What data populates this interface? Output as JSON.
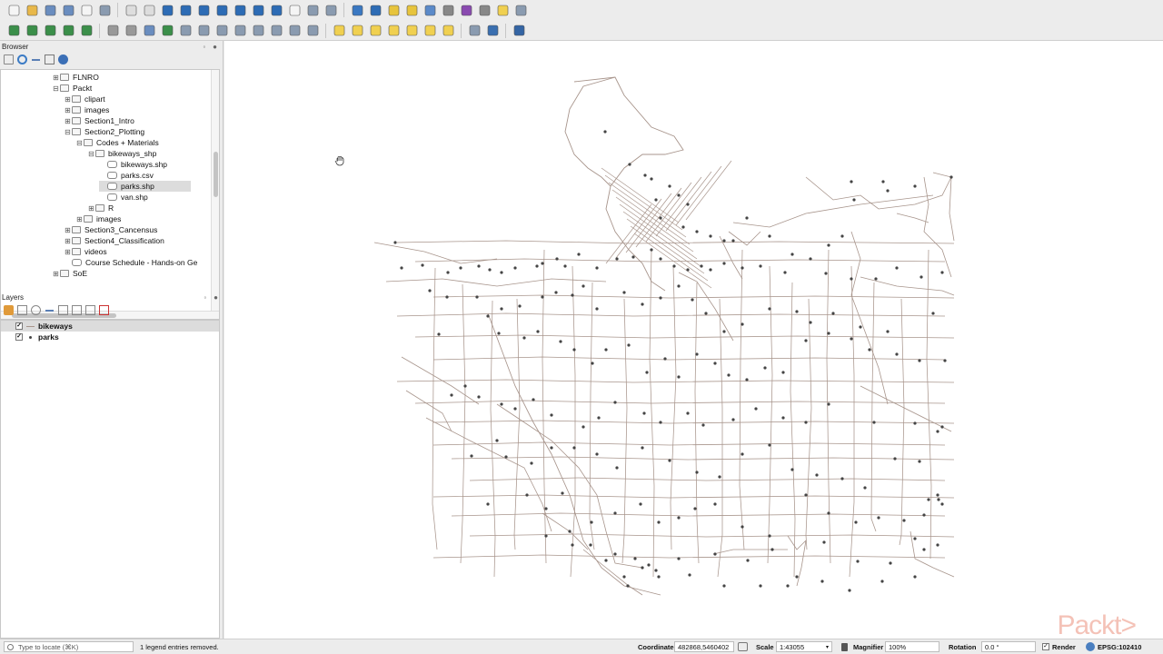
{
  "browser": {
    "title": "Browser",
    "tree": [
      {
        "label": "FLNRO",
        "depth": 0,
        "exp": "+"
      },
      {
        "label": "Packt",
        "depth": 0,
        "exp": "−"
      },
      {
        "label": "clipart",
        "depth": 1,
        "exp": "+"
      },
      {
        "label": "images",
        "depth": 1,
        "exp": "+"
      },
      {
        "label": "Section1_Intro",
        "depth": 1,
        "exp": "+"
      },
      {
        "label": "Section2_Plotting",
        "depth": 1,
        "exp": "−"
      },
      {
        "label": "Codes + Materials",
        "depth": 2,
        "exp": "−"
      },
      {
        "label": "bikeways_shp",
        "depth": 3,
        "exp": "−"
      },
      {
        "label": "bikeways.shp",
        "depth": 4,
        "exp": "",
        "file": true
      },
      {
        "label": "parks.csv",
        "depth": 4,
        "exp": "",
        "file": true
      },
      {
        "label": "parks.shp",
        "depth": 4,
        "exp": "",
        "file": true,
        "selected": true
      },
      {
        "label": "van.shp",
        "depth": 4,
        "exp": "",
        "file": true
      },
      {
        "label": "R",
        "depth": 3,
        "exp": "+"
      },
      {
        "label": "images",
        "depth": 2,
        "exp": "+"
      },
      {
        "label": "Section3_Cancensus",
        "depth": 1,
        "exp": "+"
      },
      {
        "label": "Section4_Classification",
        "depth": 1,
        "exp": "+"
      },
      {
        "label": "videos",
        "depth": 1,
        "exp": "+"
      },
      {
        "label": "Course Schedule - Hands-on Ge",
        "depth": 1,
        "exp": "",
        "file": true
      },
      {
        "label": "SoE",
        "depth": 0,
        "exp": "+"
      }
    ]
  },
  "layers": {
    "title": "Layers",
    "items": [
      {
        "label": "bikeways",
        "checked": true,
        "selected": true
      },
      {
        "label": "parks",
        "checked": true,
        "selected": false
      }
    ]
  },
  "status": {
    "locate_placeholder": "Type to locate (⌘K)",
    "message": "1 legend entries removed.",
    "coordinate_label": "Coordinate",
    "coordinate_value": "482868,5460402",
    "scale_label": "Scale",
    "scale_value": "1:43055",
    "magnifier_label": "Magnifier",
    "magnifier_value": "100%",
    "rotation_label": "Rotation",
    "rotation_value": "0.0 °",
    "render_label": "Render",
    "crs": "EPSG:102410"
  },
  "watermark": "Packt>",
  "colors": {
    "roads": "#a8958c",
    "parks": "#444444"
  }
}
